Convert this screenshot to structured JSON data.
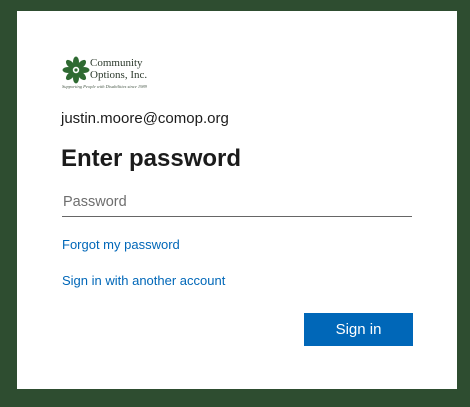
{
  "logo": {
    "name": "Community\nOptions, Inc.",
    "tagline": "Supporting People with Disabilities since 1989"
  },
  "identity": {
    "email": "justin.moore@comop.org"
  },
  "page": {
    "title": "Enter password"
  },
  "password_field": {
    "placeholder": "Password",
    "value": ""
  },
  "links": {
    "forgot_password": "Forgot my password",
    "other_account": "Sign in with another account"
  },
  "actions": {
    "signin_label": "Sign in"
  },
  "colors": {
    "background": "#2e4d30",
    "card": "#ffffff",
    "accent": "#0067b8",
    "logo_green": "#2f6a32"
  }
}
